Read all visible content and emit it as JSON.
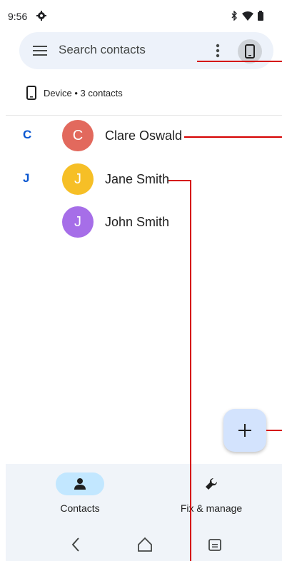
{
  "status_bar": {
    "time": "9:56"
  },
  "search": {
    "placeholder": "Search contacts"
  },
  "account": {
    "label": "Device • 3 contacts"
  },
  "contacts": [
    {
      "section": "C",
      "initial": "C",
      "name": "Clare Oswald",
      "color": "#e2695d"
    },
    {
      "section": "J",
      "initial": "J",
      "name": "Jane Smith",
      "color": "#f6bf26"
    },
    {
      "section": "",
      "initial": "J",
      "name": "John Smith",
      "color": "#a66ee8"
    }
  ],
  "bottom_nav": {
    "contacts_label": "Contacts",
    "fix_label": "Fix & manage"
  },
  "colors": {
    "accent": "#0b57d0",
    "search_bg": "#edf2fa",
    "fab_bg": "#d3e3fd",
    "nav_bg": "#f0f4f9"
  }
}
